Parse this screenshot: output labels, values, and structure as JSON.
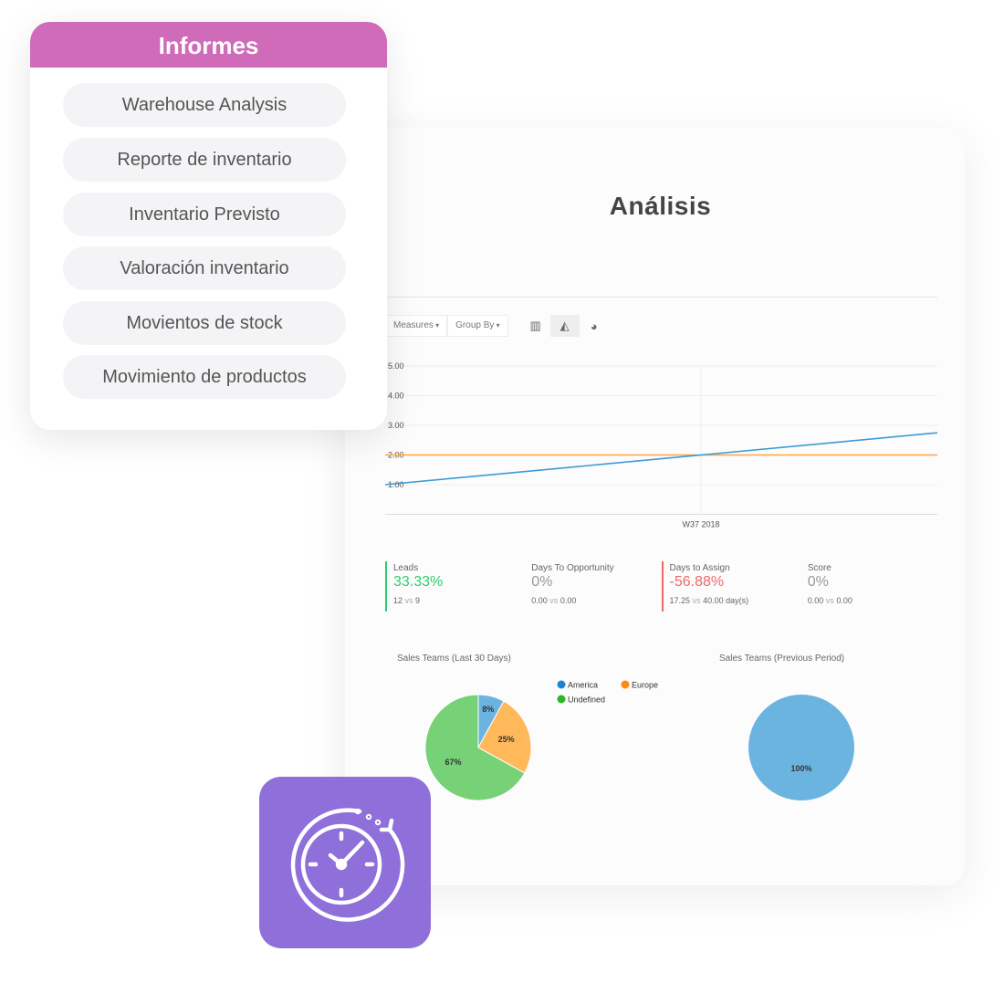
{
  "sidebar": {
    "title": "Informes",
    "items": [
      {
        "label": "Warehouse Analysis"
      },
      {
        "label": "Reporte de inventario"
      },
      {
        "label": "Inventario Previsto"
      },
      {
        "label": "Valoración inventario"
      },
      {
        "label": "Movientos de stock"
      },
      {
        "label": "Movimiento de productos"
      }
    ]
  },
  "main": {
    "title": "Análisis",
    "toolbar": {
      "measures": "Measures",
      "group_by": "Group By",
      "icons": [
        "bar-chart-icon",
        "line-chart-icon",
        "pie-chart-icon"
      ],
      "active": "line-chart-icon"
    },
    "kpis": [
      {
        "label": "Leads",
        "value": "33.33%",
        "sub_a": "12",
        "vs": "vs",
        "sub_b": "9",
        "color": "#2ecc71"
      },
      {
        "label": "Days To Opportunity",
        "value": "0%",
        "sub_a": "0.00",
        "vs": "vs",
        "sub_b": "0.00",
        "color": ""
      },
      {
        "label": "Days to Assign",
        "value": "-56.88%",
        "sub_a": "17.25",
        "vs": "vs",
        "sub_b": "40.00 day(s)",
        "color": "#f06767"
      },
      {
        "label": "Score",
        "value": "0%",
        "sub_a": "0.00",
        "vs": "vs",
        "sub_b": "0.00",
        "color": ""
      }
    ]
  },
  "chart_data": [
    {
      "type": "line",
      "x": [
        "",
        "W37 2018",
        ""
      ],
      "xticks": [
        "W37 2018"
      ],
      "ylim": [
        0,
        5
      ],
      "yticks": [
        "1.00",
        "2.00",
        "3.00",
        "4.00",
        "5.00"
      ],
      "grid": true,
      "series": [
        {
          "color": "#3d9ad6",
          "values": [
            1,
            2,
            3
          ]
        },
        {
          "color": "#ffa53d",
          "values": [
            2,
            2,
            2
          ]
        }
      ]
    },
    {
      "type": "pie",
      "title": "Sales Teams (Last 30 Days)",
      "legend": "top-right",
      "slices": [
        {
          "name": "America",
          "value": 8,
          "label": "8%",
          "color": "#6cb4e0",
          "legend_color": "#1f84d0"
        },
        {
          "name": "Europe",
          "value": 25,
          "label": "25%",
          "color": "#ffb85a",
          "legend_color": "#ff8a10"
        },
        {
          "name": "Undefined",
          "value": 67,
          "label": "67%",
          "color": "#77d177",
          "legend_color": "#2bb52b"
        }
      ]
    },
    {
      "type": "pie",
      "title": "Sales Teams (Previous Period)",
      "slices": [
        {
          "value": 100,
          "label": "100%",
          "color": "#6cb4e0"
        }
      ]
    }
  ],
  "badge": {
    "icon": "stopwatch-refresh-icon",
    "color": "#8F6FD9"
  }
}
